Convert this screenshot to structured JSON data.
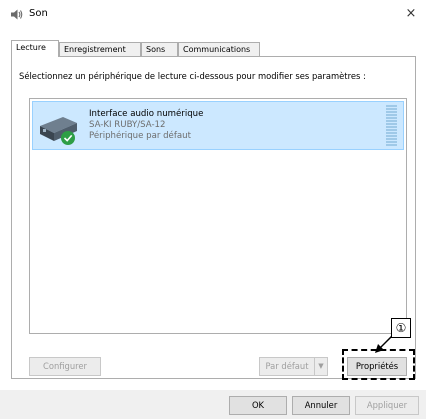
{
  "window": {
    "title": "Son",
    "close_label": "×"
  },
  "tabs": [
    {
      "label": "Lecture",
      "active": true
    },
    {
      "label": "Enregistrement",
      "active": false
    },
    {
      "label": "Sons",
      "active": false
    },
    {
      "label": "Communications",
      "active": false
    }
  ],
  "instruction": "Sélectionnez un périphérique de lecture ci-dessous pour modifier ses paramètres :",
  "device": {
    "name": "Interface audio numérique",
    "model": "SA-KI RUBY/SA-12",
    "status": "Périphérique par défaut",
    "icon": "speaker-device-icon",
    "badge_icon": "check-circle-icon",
    "selected_color": "#cce8ff"
  },
  "buttons": {
    "configure": "Configurer",
    "set_default": "Par défaut",
    "default_arrow": "▼",
    "properties": "Propriétés",
    "ok": "OK",
    "cancel": "Annuler",
    "apply": "Appliquer"
  },
  "annotation": {
    "number": "①"
  }
}
